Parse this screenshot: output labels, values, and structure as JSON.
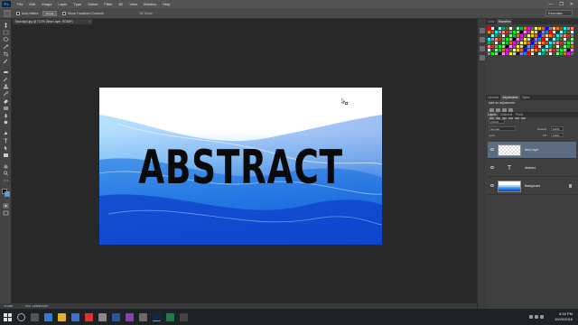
{
  "app": {
    "logo": "Ps",
    "menu": [
      "File",
      "Edit",
      "Image",
      "Layer",
      "Type",
      "Select",
      "Filter",
      "3D",
      "View",
      "Window",
      "Help"
    ],
    "window_controls": [
      "—",
      "❐",
      "✕"
    ]
  },
  "options_bar": {
    "auto_select_label": "Auto-Select:",
    "auto_select_value": "Group",
    "show_transform_label": "Show Transform Controls",
    "mode_3d_label": "3D Mode:",
    "workspace": "Essentials"
  },
  "document": {
    "tab_title": "Moonlight.jpg @ 73.3% (New Layer, RGB/8*)",
    "close": "×",
    "canvas_text": "ABSTRACT"
  },
  "status_bar": {
    "zoom": "73.33%",
    "doc_size": "Doc: 1.64M/3.61M"
  },
  "panels": {
    "swatch_tabs": [
      "Color",
      "Swatches"
    ],
    "adjust_tabs": [
      "Libraries",
      "Adjustments",
      "Styles"
    ],
    "adjust_title": "Add an adjustment",
    "layer_tabs": [
      "Layers",
      "Channels",
      "Paths"
    ],
    "kind_label": "ρ Kind",
    "blend_mode": "Normal",
    "opacity_label": "Opacity:",
    "opacity_value": "100%",
    "lock_label": "Lock:",
    "fill_label": "Fill:",
    "fill_value": "100%",
    "layers": [
      {
        "name": "New Layer",
        "selected": true
      },
      {
        "name": "Abstract",
        "selected": false
      },
      {
        "name": "Background",
        "selected": false
      }
    ],
    "swatch_colors": [
      "#ff0000",
      "#ffff00",
      "#00ff00",
      "#00ffff",
      "#0000ff",
      "#ff00ff",
      "#ffffff",
      "#e6e6e6",
      "#cccccc",
      "#b3b3b3",
      "#999999",
      "#808080",
      "#666666",
      "#4d4d4d",
      "#333333",
      "#1a1a1a",
      "#000000",
      "#ff8080",
      "#ffcc80",
      "#ffff80",
      "#80ff80",
      "#80ffff",
      "#8080ff",
      "#ff80ff",
      "#c0392b",
      "#e67e22",
      "#f1c40f",
      "#27ae60",
      "#16a085",
      "#2980b9",
      "#8e44ad",
      "#7f8c8d",
      "#a0522d",
      "#d2691e",
      "#b8860b",
      "#556b2f"
    ]
  },
  "taskbar": {
    "time": "8:16 PM",
    "date": "10/20/2016"
  },
  "colors": {
    "foreground": "#000000",
    "background": "#33aaff",
    "selected_layer": "#5a6b82"
  }
}
